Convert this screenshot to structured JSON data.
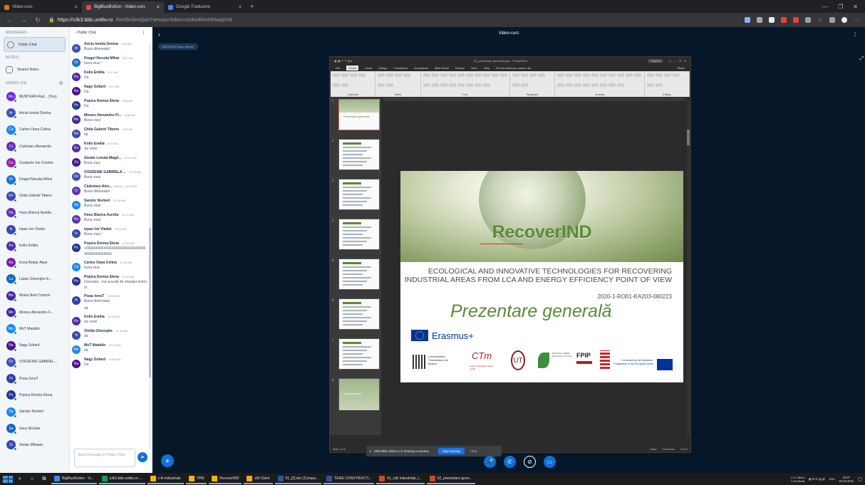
{
  "browser": {
    "tabs": [
      {
        "label": "Video-curs",
        "active": false,
        "color": "#d97706"
      },
      {
        "label": "BigBlueButton - Video-curs",
        "active": true,
        "color": "#ef4444"
      },
      {
        "label": "Google Traducere",
        "active": false,
        "color": "#4285f4"
      }
    ],
    "new_tab": "+",
    "url_host": "https://s3k3.bbb.unitbv.ro",
    "url_path": "/html5client/join?sessionToken=zioho4hme95wq2md"
  },
  "sidebar": {
    "messages_header": "MESSAGES",
    "public_chat": "Public Chat",
    "notes_header": "NOTES",
    "shared_notes": "Shared Notes",
    "users_header": "USERS (29)",
    "users": [
      {
        "initials": "Mu",
        "name": "MUNTEAN Rad... (You)",
        "color": "#6d28d9"
      },
      {
        "initials": "Ar",
        "name": "Ariciu Ionela Denisa",
        "color": "#3f51b5"
      },
      {
        "initials": "Ca",
        "name": "Cartes Oana Celina",
        "color": "#1e88e5"
      },
      {
        "initials": "Ci",
        "name": "Ciubotaru Alexandru",
        "color": "#5e35b1"
      },
      {
        "initials": "Co",
        "name": "Costache Ion Cosmin",
        "color": "#8e24aa"
      },
      {
        "initials": "Dr",
        "name": "Dragoi Neculai Mihai",
        "color": "#1976d2"
      },
      {
        "initials": "Gh",
        "name": "Ghita Gabriel Tiberiu",
        "color": "#3949ab"
      },
      {
        "initials": "Hu",
        "name": "Husu Bianca Aurelia",
        "color": "#5e35b1"
      },
      {
        "initials": "Is",
        "name": "Ispas Ion Vladut",
        "color": "#3949ab"
      },
      {
        "initials": "Ko",
        "name": "Kollo Emilia",
        "color": "#512da8"
      },
      {
        "initials": "Ko",
        "name": "Kosa Aladar Alpar",
        "color": "#7b1fa2"
      },
      {
        "initials": "La",
        "name": "Latsiu Gheorghe E...",
        "color": "#1565c0"
      },
      {
        "initials": "Mo",
        "name": "Moisa Noel Cosmin",
        "color": "#4527a0"
      },
      {
        "initials": "Mo",
        "name": "Moraru Alexandru F...",
        "color": "#4527a0"
      },
      {
        "initials": "Mo",
        "name": "MoT Madalin",
        "color": "#1e88e5"
      },
      {
        "initials": "Na",
        "name": "Nagy Szilard",
        "color": "#4a148c"
      },
      {
        "initials": "Ov",
        "name": "OVEDENIE GABRIEL...",
        "color": "#3f51b5"
      },
      {
        "initials": "Pi",
        "name": "Pisau IonuT",
        "color": "#303f9f"
      },
      {
        "initials": "Po",
        "name": "Popica Denisa Elena",
        "color": "#283593"
      },
      {
        "initials": "Sa",
        "name": "Sandor Norbert",
        "color": "#1e88e5"
      },
      {
        "initials": "Sa",
        "name": "Savu Nicolae",
        "color": "#1565c0"
      },
      {
        "initials": "St",
        "name": "Stoian Mihaela",
        "color": "#3949ab"
      }
    ]
  },
  "chat": {
    "back_label": "Public Chat",
    "menu": "⋮",
    "input_placeholder": "Send message to Public Chat",
    "messages": [
      {
        "initials": "Ar",
        "color": "#3f51b5",
        "name": "Ariciu Ionela Denisa",
        "time": "9:56 AM",
        "offline": "",
        "text": "Buna dimineata!"
      },
      {
        "initials": "Dr",
        "color": "#1976d2",
        "name": "Dragoi Neculai Mihai",
        "time": "9:57 AM",
        "offline": "",
        "text": "buna ziua !"
      },
      {
        "initials": "Ko",
        "color": "#512da8",
        "name": "Kollo Emilia",
        "time": "9:57 AM",
        "offline": "",
        "text": "Da"
      },
      {
        "initials": "Na",
        "color": "#4a148c",
        "name": "Nagy Szilard",
        "time": "9:57 AM",
        "offline": "",
        "text": "Da"
      },
      {
        "initials": "Po",
        "color": "#283593",
        "name": "Popica Denisa Elena",
        "time": "9:58 AM",
        "offline": "",
        "text": "Da"
      },
      {
        "initials": "Mo",
        "color": "#4527a0",
        "name": "Moraru Alexandru Fl...",
        "time": "9:58 AM",
        "offline": "",
        "text": "Buna ziua!"
      },
      {
        "initials": "Gh",
        "color": "#3949ab",
        "name": "Ghita Gabriel Tiberiu",
        "time": "9:59 AM",
        "offline": "",
        "text": "da"
      },
      {
        "initials": "Ko",
        "color": "#512da8",
        "name": "Kollo Emilia",
        "time": "9:59 AM",
        "offline": "",
        "text": "Se vede"
      },
      {
        "initials": "Za",
        "color": "#4a148c",
        "name": "Zavate Lenuta Magd...",
        "time": "10:01 AM",
        "offline": "",
        "text": "Buna ziua"
      },
      {
        "initials": "Ov",
        "color": "#3f51b5",
        "name": "OVEDENIE GABRIELA ...",
        "time": "10:02 AM",
        "offline": "",
        "text": "Buna ziua!"
      },
      {
        "initials": "Ci",
        "color": "#5e35b1",
        "name": "Ciubotaru Alex...",
        "time": "10:03 AM",
        "offline": "(offline)",
        "text": "Buna dimineata!"
      },
      {
        "initials": "Sa",
        "color": "#1e88e5",
        "name": "Sandor Norbert",
        "time": "10:03 AM",
        "offline": "",
        "text": "Buna ziua!"
      },
      {
        "initials": "Hu",
        "color": "#5e35b1",
        "name": "Husu Bianca Aurelia",
        "time": "10:03 AM",
        "offline": "",
        "text": "Buna ziua!"
      },
      {
        "initials": "Is",
        "color": "#3949ab",
        "name": "Ispas Ion Vladut",
        "time": "10:04 AM",
        "offline": "",
        "text": "Buna ziua !"
      },
      {
        "initials": "Po",
        "color": "#283593",
        "name": "Popica Denisa Elena",
        "time": "10:05 AM",
        "offline": "",
        "text": "+66666666666666666666666666666666666666666666"
      },
      {
        "initials": "Ca",
        "color": "#1e88e5",
        "name": "Cartes Oana Celina",
        "time": "10:05 AM",
        "offline": "",
        "text": "buna ziua"
      },
      {
        "initials": "Po",
        "color": "#283593",
        "name": "Popica Denisa Elena",
        "time": "10:05 AM",
        "offline": "",
        "text": "Greseala , ma scuzati de mesajul anterior"
      },
      {
        "initials": "Pi",
        "color": "#303f9f",
        "name": "Pisau IonuT",
        "time": "10:06 AM",
        "offline": "",
        "text": "Buna dimineata!"
      },
      {
        "initials": "",
        "color": "",
        "name": "",
        "time": "",
        "offline": "",
        "text": "da"
      },
      {
        "initials": "Ko",
        "color": "#512da8",
        "name": "Kollo Emilia",
        "time": "10:06 AM",
        "offline": "",
        "text": "Se vede"
      },
      {
        "initials": "Vi",
        "color": "#3949ab",
        "name": "Vintila Gheorghe",
        "time": "10:06 AM",
        "offline": "",
        "text": "da"
      },
      {
        "initials": "Mo",
        "color": "#1e88e5",
        "name": "MoT Madalin",
        "time": "10:06 AM",
        "offline": "",
        "text": "da"
      },
      {
        "initials": "Na",
        "color": "#4a148c",
        "name": "Nagy Szilard",
        "time": "10:06 AM",
        "offline": "",
        "text": "Da"
      }
    ]
  },
  "main": {
    "title": "Video-curs",
    "presenter": "MUNTEAN Radu Mircea"
  },
  "ppt": {
    "filename": "02_prezentare generala.pptx - PowerPoint",
    "sign_in": "Sign in",
    "menu": [
      "File",
      "Home",
      "Insert",
      "Design",
      "Transitions",
      "Animations",
      "Slide Show",
      "Review",
      "View",
      "Help",
      "Tell me what you want to do"
    ],
    "share": "Share",
    "ribbon_groups": [
      "Clipboard",
      "Slides",
      "Font",
      "Paragraph",
      "Drawing",
      "Editing"
    ],
    "slide_count": [
      "1",
      "2",
      "3",
      "4",
      "5",
      "6",
      "7",
      "8"
    ],
    "status_left": "Slide 1 of 8",
    "status_notes": "Notes",
    "status_comments": "Comments",
    "status_zoom": "104 %"
  },
  "slide": {
    "brand": "RecoverIND",
    "subtitle": "ECOLOGICAL AND INNOVATIVE TECHNOLOGIES FOR RECOVERING INDUSTRIAL AREAS FROM LCA AND ENERGY EFFICIENCY POINT OF VIEW",
    "code": "2020-1-RO01-KA203-080223",
    "title": "Prezentare generală",
    "erasmus": "Erasmus+",
    "unitbv": "Universitatea Transilvania din Brașov",
    "ctm": "CTm",
    "ctm_sub": "Centru Tehnologic pentru mediu",
    "ut": "UT",
    "rgbc": "ROMANIA GREEN BUILDING COUNCIL",
    "fpip": "FPIP",
    "eu_text": "Co-funded by the Erasmus+ Programme of the European Union",
    "thumb_title": "Prezentare generală",
    "thumb_last": "Vă mulțumesc!"
  },
  "overlay": {
    "share_msg": "s3k3.bbb.unitbv.ro is sharing a window.",
    "stop_sharing": "Stop sharing",
    "hide": "Hide"
  },
  "taskbar": {
    "apps": [
      {
        "label": "BigBlueButton - Vi...",
        "color": "#4285f4"
      },
      {
        "label": "s3k3.bbb.unitbv.ro ...",
        "color": "#0f9d58"
      },
      {
        "label": "c-tii industriale",
        "color": "#f4b400"
      },
      {
        "label": "TPM",
        "color": "#f4b400"
      },
      {
        "label": "RecoverIND",
        "color": "#f4b400"
      },
      {
        "label": "eM Client",
        "color": "#f9a825"
      },
      {
        "label": "01_[2].doc [Compa...",
        "color": "#2b579a"
      },
      {
        "label": "TEME CONSTRUCTI...",
        "color": "#2b579a"
      },
      {
        "label": "01_c(tii industriale_i...",
        "color": "#d24726"
      },
      {
        "label": "02_prezentare gene...",
        "color": "#d24726"
      }
    ],
    "net_up": "0.11 Mbit/s",
    "net_down": "0.06 Mbit/s",
    "lang": "ENG",
    "time": "10:07",
    "date": "03.03.2021"
  }
}
